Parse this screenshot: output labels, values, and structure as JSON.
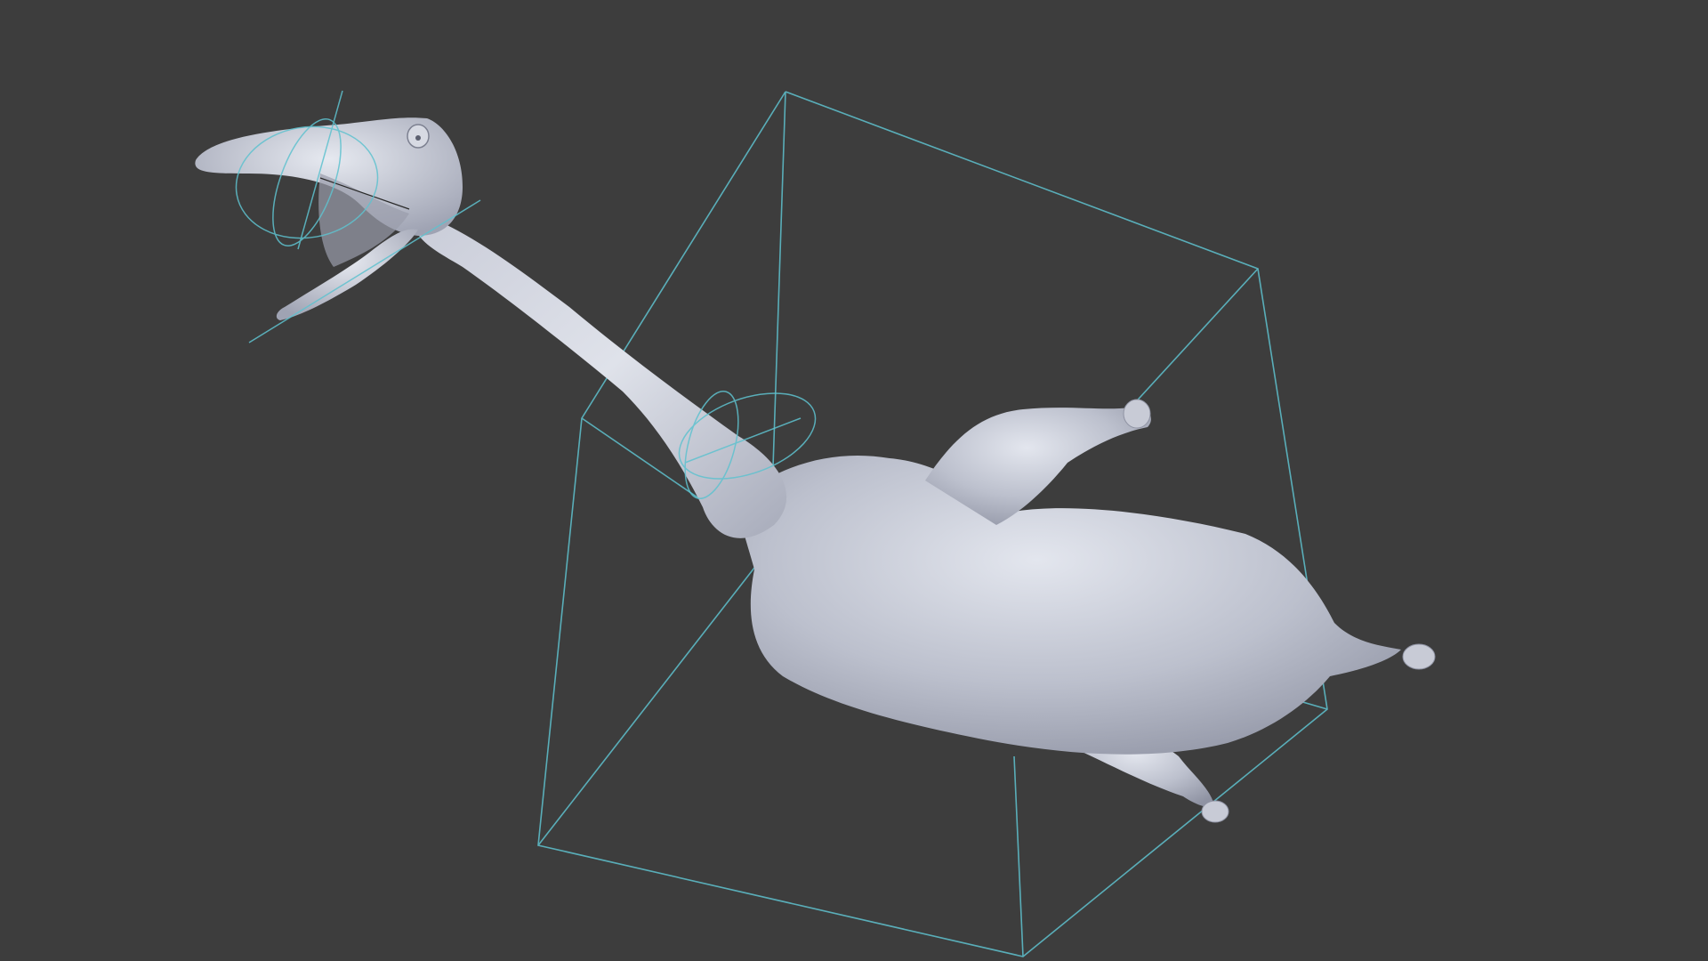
{
  "viewport": {
    "background_color": "#3d3d3d",
    "mesh_color": "#b9bdca",
    "mesh_shadow_color": "#8f93a3",
    "mesh_highlight_color": "#e3e6ee",
    "control_rig_color": "#5fc2cf",
    "object": "creature-sculpt",
    "rig_controls": [
      "head-controller",
      "neck-controller",
      "body-cage"
    ]
  }
}
